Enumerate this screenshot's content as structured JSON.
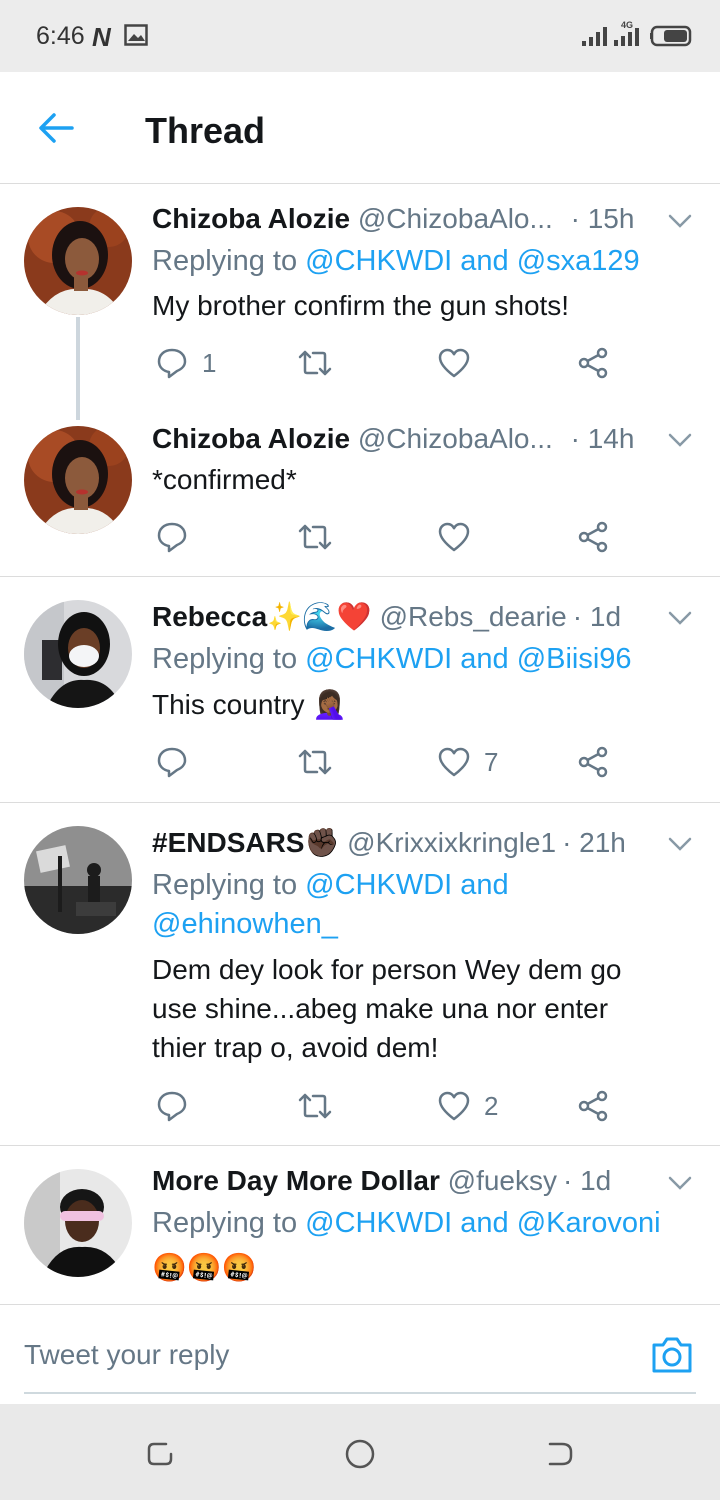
{
  "status_bar": {
    "time": "6:46",
    "network": "4G"
  },
  "header": {
    "title": "Thread"
  },
  "tweets": [
    {
      "name": "Chizoba Alozie",
      "handle": "@ChizobaAlo...",
      "time": "· 15h",
      "reply_prefix": "Replying to",
      "reply_to": "@CHKWDI and @sxa129",
      "text": "My brother confirm the gun shots!",
      "reply_count": "1",
      "retweet_count": "",
      "like_count": ""
    },
    {
      "name": "Chizoba Alozie",
      "handle": "@ChizobaAlo...",
      "time": "· 14h",
      "text": "*confirmed*",
      "reply_count": "",
      "retweet_count": "",
      "like_count": ""
    },
    {
      "name": "Rebecca",
      "name_emoji": "✨🌊❤️",
      "handle": "@Rebs_dearie",
      "time": "· 1d",
      "reply_prefix": "Replying to",
      "reply_to": "@CHKWDI and @Biisi96",
      "text": "This country 🤦🏾‍♀️",
      "reply_count": "",
      "retweet_count": "",
      "like_count": "7"
    },
    {
      "name": "#ENDSARS",
      "name_emoji": "✊🏿",
      "handle": "@Krixxixkringle1",
      "time": "· 21h",
      "reply_prefix": "Replying to",
      "reply_to_1": "@CHKWDI and",
      "reply_to_2": "@ehinowhen_",
      "text": "Dem dey look for person Wey dem go use shine...abeg make una nor enter thier trap o, avoid dem!",
      "reply_count": "",
      "retweet_count": "",
      "like_count": "2"
    },
    {
      "name": "More Day More Dollar",
      "handle": "@fueksy",
      "time": "· 1d",
      "reply_prefix": "Replying to",
      "reply_to": "@CHKWDI and @Karovoni",
      "text": "🤬🤬🤬"
    }
  ],
  "composer": {
    "placeholder": "Tweet your reply"
  },
  "colors": {
    "accent": "#1da1f2",
    "secondary_text": "#657786",
    "primary_text": "#14171a",
    "divider": "#dcdcdc"
  }
}
